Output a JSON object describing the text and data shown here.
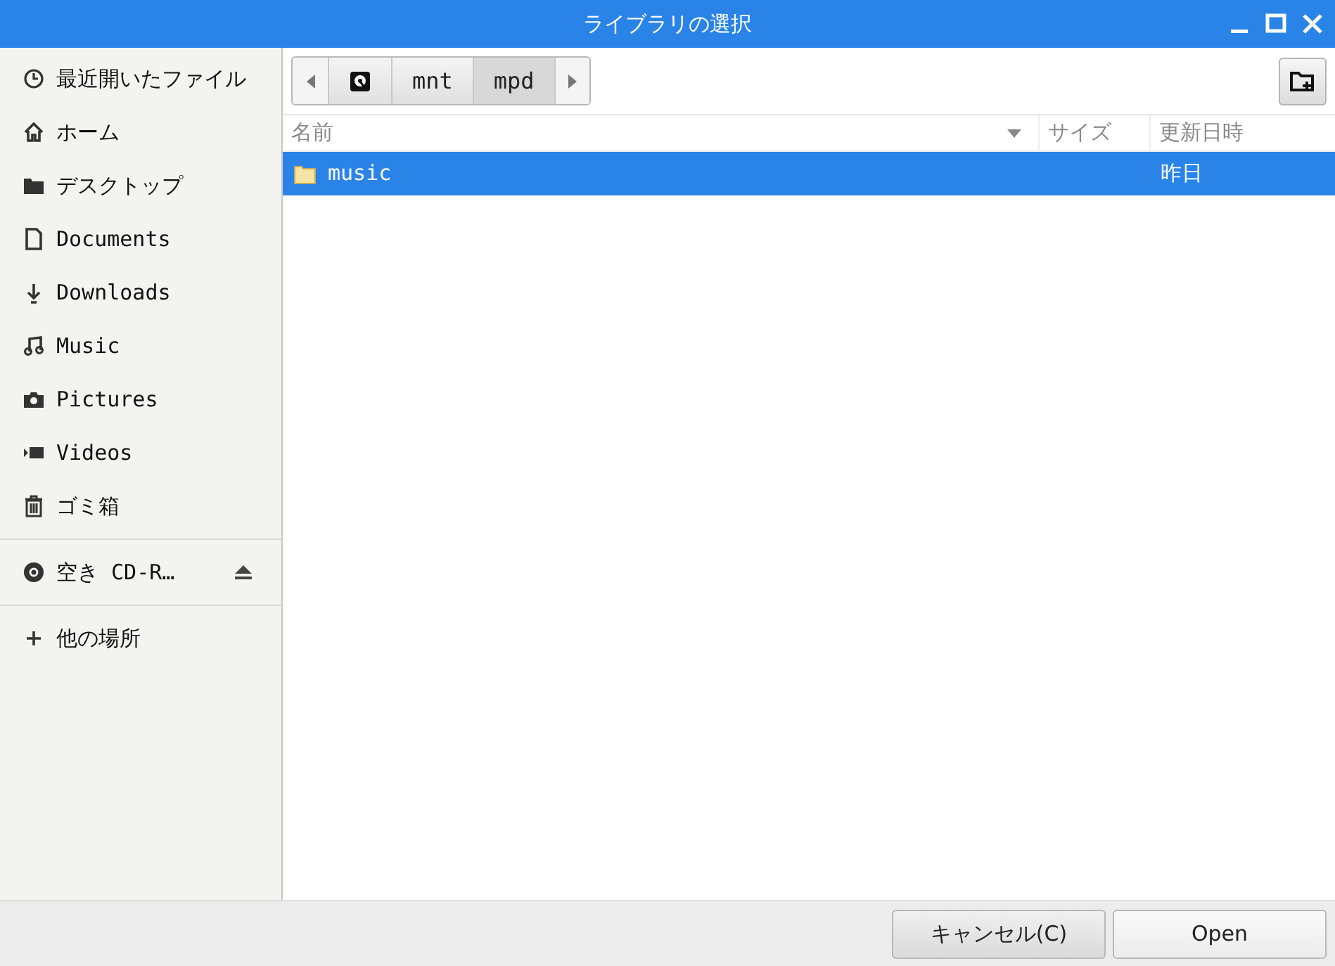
{
  "window": {
    "title": "ライブラリの選択"
  },
  "sidebar": {
    "sections": [
      [
        {
          "label": "最近開いたファイル"
        },
        {
          "label": "ホーム"
        },
        {
          "label": "デスクトップ"
        },
        {
          "label": "Documents"
        },
        {
          "label": "Downloads"
        },
        {
          "label": "Music"
        },
        {
          "label": "Pictures"
        },
        {
          "label": "Videos"
        },
        {
          "label": "ゴミ箱"
        }
      ],
      [
        {
          "label": "空き CD-R…",
          "ejectable": true
        }
      ],
      [
        {
          "label": "他の場所"
        }
      ]
    ]
  },
  "path_bar": {
    "segments": [
      {
        "kind": "drive",
        "selected": false
      },
      {
        "label": "mnt",
        "selected": false
      },
      {
        "label": "mpd",
        "selected": true
      }
    ]
  },
  "file_list": {
    "columns": [
      {
        "label": "名前",
        "sorted": true
      },
      {
        "label": "サイズ",
        "sorted": false
      },
      {
        "label": "更新日時",
        "sorted": false
      }
    ],
    "rows": [
      {
        "name": "music",
        "size": "",
        "modified": "昨日",
        "selected": true
      }
    ]
  },
  "buttons": [
    {
      "label": "キャンセル(C)"
    },
    {
      "label": "Open"
    }
  ]
}
